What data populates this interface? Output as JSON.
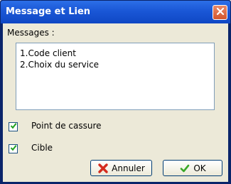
{
  "window": {
    "title": "Message et Lien"
  },
  "messages": {
    "label": "Messages :",
    "lines": [
      "1.Code client",
      "2.Choix du service"
    ]
  },
  "options": [
    {
      "label": "Point de cassure",
      "checked": true
    },
    {
      "label": "Cible",
      "checked": true
    }
  ],
  "buttons": {
    "cancel_label": "Annuler",
    "ok_label": "OK"
  },
  "colors": {
    "title_bar": "#1a57d6",
    "client_bg": "#ece9d8",
    "cancel_icon": "#d42b1e",
    "ok_icon": "#3aa829"
  }
}
